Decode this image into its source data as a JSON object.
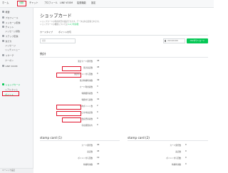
{
  "header": {
    "tabs": [
      {
        "label": "ホーム"
      },
      {
        "label": "分析"
      },
      {
        "label": "チャット"
      },
      {
        "label": "プロフィール"
      },
      {
        "label": "LINE VOOM"
      },
      {
        "label": "拡張機能"
      },
      {
        "label": "設定"
      }
    ],
    "active_tab": "分析",
    "highlight_color": "#e0142c",
    "accent_color": "#06c755"
  },
  "sidebar": {
    "items": [
      {
        "label": "概要"
      },
      {
        "label": "プロフィール"
      },
      {
        "label": "メッセージ配信"
      },
      {
        "label": "チャット"
      },
      {
        "label": "メッセージ通数"
      },
      {
        "label": "ステップ配信"
      },
      {
        "label": "友だち"
      },
      {
        "label": "メッセージ"
      },
      {
        "label": "リッチメニュー"
      },
      {
        "label": "リサーチ"
      },
      {
        "label": "クーポン"
      },
      {
        "label": "LINE VOOM"
      },
      {
        "label": "ショップカード"
      },
      {
        "label": "リアルタイム"
      },
      {
        "label": "ポイント"
      }
    ],
    "footer_label": "ベーシック設定"
  },
  "main": {
    "title": "ショップカード",
    "description_1": "ショップカードの利用状況を確認できます。データは毎日更新されます。",
    "description_2": "ショップカードの機能については",
    "description_link": "ヘルプを参照",
    "subtabs": [
      {
        "label": "カードタイプ"
      },
      {
        "label": "ポイント付与"
      }
    ],
    "search_placeholder": "検索",
    "date_value": "2023/03/09",
    "download_button": "CSVダウンロード",
    "overview": {
      "heading": "統計",
      "rows": [
        {
          "label": "累計カード発行数",
          "value": "45"
        },
        {
          "label": "累計来店数",
          "value": "45"
        },
        {
          "label": "累計ポイント付与回数",
          "value": "0"
        },
        {
          "label": "累計特典利用数",
          "value": "49"
        },
        {
          "label": "カード利用者数",
          "value": "3"
        },
        {
          "label": "特典獲得者数",
          "value": "5"
        },
        {
          "label": "特典付与者数",
          "value": "41"
        },
        {
          "label": "平均ポイント数",
          "value": "2"
        },
        {
          "label": "1日平均来店数",
          "value": "0"
        },
        {
          "label": "会員登録者数",
          "value": "0"
        },
        {
          "label": "有効期限切れ",
          "value": "0"
        }
      ]
    },
    "card1": {
      "heading": "stamp card (1)",
      "rows": [
        {
          "label": "カード発行数",
          "value": "40"
        },
        {
          "label": "来店数",
          "value": "45"
        },
        {
          "label": "ポイント付与回数",
          "value": "19"
        },
        {
          "label": "特典利用数",
          "value": "45"
        }
      ]
    },
    "card2": {
      "heading": "stamp card (2)",
      "rows": [
        {
          "label": "カード発行数",
          "value": "0"
        },
        {
          "label": "来店数",
          "value": "0"
        },
        {
          "label": "ポイント付与回数",
          "value": "0"
        },
        {
          "label": "特典利用数",
          "value": "0"
        }
      ]
    }
  }
}
